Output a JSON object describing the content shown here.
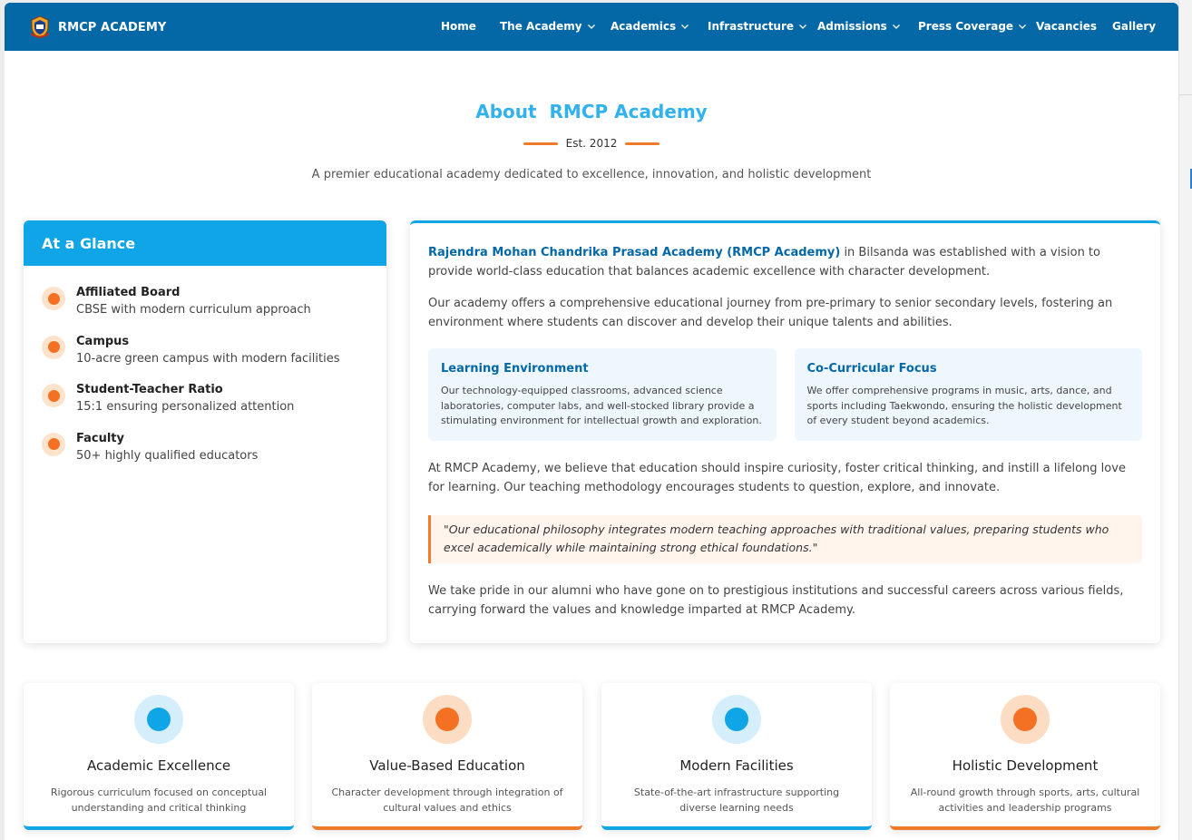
{
  "colors": {
    "nav_bg": "#0467a6",
    "accent_blue": "#10a5e6",
    "title_blue": "#31b2ef",
    "accent_orange": "#f07b2b"
  },
  "nav": {
    "brand": "RMCP ACADEMY",
    "items": [
      {
        "label": "Home",
        "dropdown": false
      },
      {
        "label": "The Academy",
        "dropdown": true
      },
      {
        "label": "Academics",
        "dropdown": true
      },
      {
        "label": "Infrastructure",
        "dropdown": true
      },
      {
        "label": "Admissions",
        "dropdown": true
      },
      {
        "label": "Press Coverage",
        "dropdown": true
      },
      {
        "label": "Vacancies",
        "dropdown": false
      },
      {
        "label": "Gallery",
        "dropdown": false
      }
    ]
  },
  "header": {
    "title": "About  RMCP Academy",
    "est": "Est. 2012",
    "subtitle": "A premier educational academy dedicated to excellence, innovation, and holistic development"
  },
  "glance": {
    "title": "At a Glance",
    "items": [
      {
        "title": "Affiliated Board",
        "text": "CBSE with modern curriculum approach"
      },
      {
        "title": "Campus",
        "text": "10-acre green campus with modern facilities"
      },
      {
        "title": "Student-Teacher Ratio",
        "text": "15:1 ensuring personalized attention"
      },
      {
        "title": "Faculty",
        "text": "50+ highly qualified educators"
      }
    ]
  },
  "about": {
    "intro_highlight": "Rajendra Mohan Chandrika Prasad Academy (RMCP Academy)",
    "intro_rest": " in Bilsanda was established with a vision to provide world-class education that balances academic excellence with character development.",
    "para2": "Our academy offers a comprehensive educational journey from pre-primary to senior secondary levels, fostering an environment where students can discover and develop their unique talents and abilities.",
    "features": [
      {
        "title": "Learning Environment",
        "text": "Our technology-equipped classrooms, advanced science laboratories, computer labs, and well-stocked library provide a stimulating environment for intellectual growth and exploration."
      },
      {
        "title": "Co-Curricular Focus",
        "text": "We offer comprehensive programs in music, arts, dance, and sports including Taekwondo, ensuring the holistic development of every student beyond academics."
      }
    ],
    "para3": "At RMCP Academy, we believe that education should inspire curiosity, foster critical thinking, and instill a lifelong love for learning. Our teaching methodology encourages students to question, explore, and innovate.",
    "quote": "\"Our educational philosophy integrates modern teaching approaches with traditional values, preparing students who excel academically while maintaining strong ethical foundations.\"",
    "para4": "We take pride in our alumni who have gone on to prestigious institutions and successful careers across various fields, carrying forward the values and knowledge imparted at RMCP Academy."
  },
  "pillars": [
    {
      "title": "Academic Excellence",
      "text": "Rigorous curriculum focused on conceptual understanding and critical thinking",
      "color": "blue"
    },
    {
      "title": "Value-Based Education",
      "text": "Character development through integration of cultural values and ethics",
      "color": "orange"
    },
    {
      "title": "Modern Facilities",
      "text": "State-of-the-art infrastructure supporting diverse learning needs",
      "color": "blue"
    },
    {
      "title": "Holistic Development",
      "text": "All-round growth through sports, arts, cultural activities and leadership programs",
      "color": "orange"
    }
  ]
}
